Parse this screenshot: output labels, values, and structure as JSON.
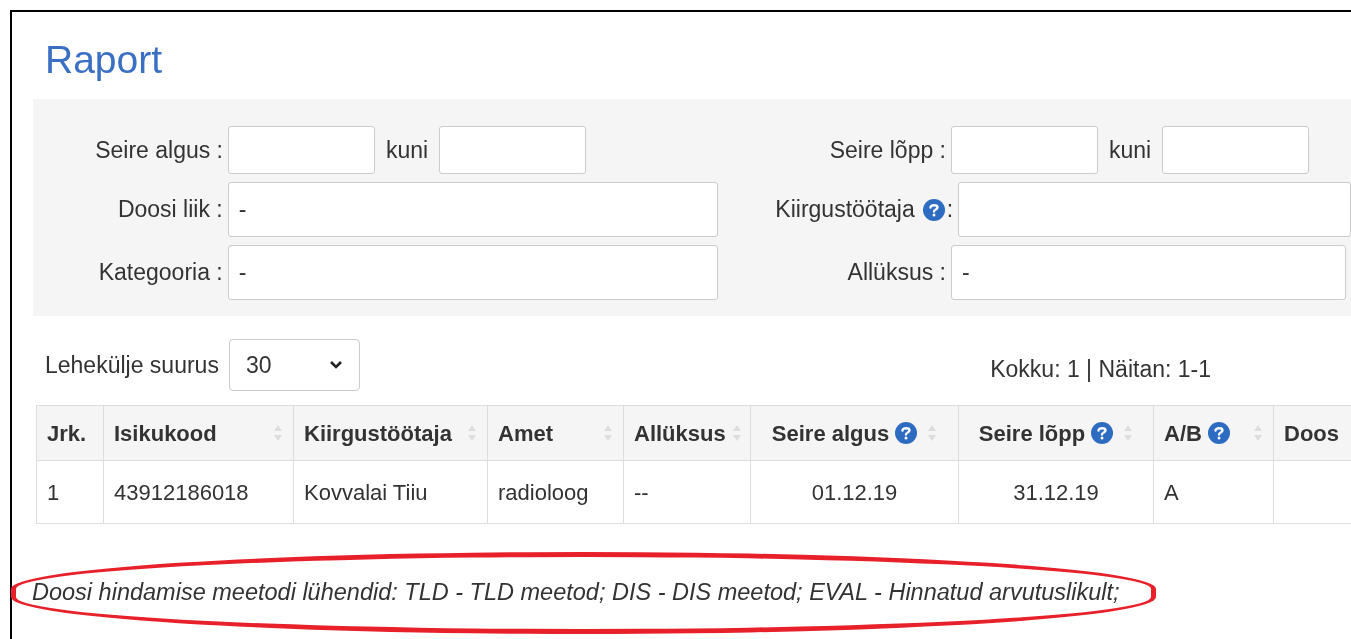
{
  "title": "Raport",
  "filters_left": [
    {
      "kind": "range",
      "label": "Seire algus :",
      "separator": "kuni"
    },
    {
      "kind": "select",
      "label": "Doosi liik :",
      "field": {
        "value": "-"
      }
    },
    {
      "kind": "select",
      "label": "Kategooria :",
      "field": {
        "value": "-"
      }
    }
  ],
  "filters_right": [
    {
      "kind": "range",
      "label": "Seire lõpp :",
      "separator": "kuni"
    },
    {
      "kind": "text",
      "label": "Kiirgustöötaja",
      "help": true,
      "suffix": ":"
    },
    {
      "kind": "select",
      "label": "Allüksus :",
      "field": {
        "value": "-"
      }
    }
  ],
  "page_size": {
    "label": "Lehekülje suurus",
    "value": "30"
  },
  "summary": "Kokku: 1 | Näitan: 1-1",
  "table": {
    "columns": [
      {
        "label": "Jrk.",
        "sortable": false,
        "help": false
      },
      {
        "label": "Isikukood",
        "sortable": true,
        "help": false
      },
      {
        "label": "Kiirgustöötaja",
        "sortable": true,
        "help": false
      },
      {
        "label": "Amet",
        "sortable": true,
        "help": false
      },
      {
        "label": "Allüksus",
        "sortable": true,
        "help": false
      },
      {
        "label": "Seire algus",
        "sortable": true,
        "help": true
      },
      {
        "label": "Seire lõpp",
        "sortable": true,
        "help": true
      },
      {
        "label": "A/B",
        "sortable": true,
        "help": true
      },
      {
        "label": "Doos"
      }
    ],
    "rows": [
      [
        "1",
        "43912186018",
        "Kovvalai Tiiu",
        "radioloog",
        "--",
        "01.12.19",
        "31.12.19",
        "A",
        ""
      ]
    ]
  },
  "footnote": "Doosi hindamise meetodi lühendid: TLD - TLD meetod; DIS - DIS meetod; EVAL - Hinnatud arvutuslikult;"
}
